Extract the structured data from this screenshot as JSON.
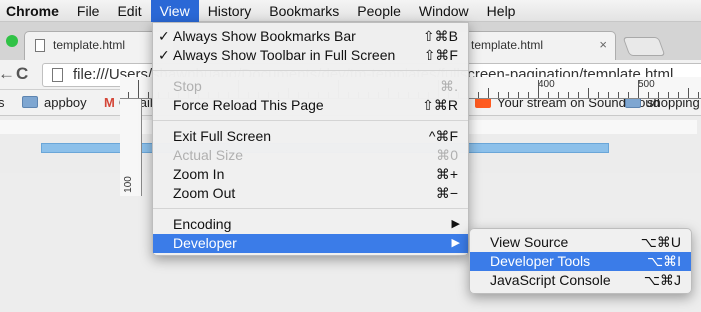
{
  "menubar": {
    "app": "Chrome",
    "items": [
      "File",
      "Edit",
      "View",
      "History",
      "Bookmarks",
      "People",
      "Window",
      "Help"
    ]
  },
  "tabs": [
    {
      "title": "template.html"
    },
    {
      "title": "template.html",
      "close": "×"
    }
  ],
  "toolbar": {
    "back": "←",
    "reload": "C",
    "url": "file:///Users/shawnhuang/Documents/dev/tm-templates/fullscreen-pagination/template.html"
  },
  "bookmarks": [
    {
      "label": "s",
      "icon": "bookmark-icon"
    },
    {
      "label": "appboy",
      "icon": "folder-icon"
    },
    {
      "label": "Gmail",
      "icon": "gmail-icon"
    },
    {
      "label": "Your stream on SoundCloud",
      "icon": "soundcloud-icon"
    },
    {
      "label": "shopping",
      "icon": "folder-icon"
    }
  ],
  "ruler": {
    "labels": [
      "400",
      "500",
      "100"
    ]
  },
  "view_menu": {
    "items": [
      {
        "check": "✓",
        "label": "Always Show Bookmarks Bar",
        "shortcut": "⇧⌘B"
      },
      {
        "check": "✓",
        "label": "Always Show Toolbar in Full Screen",
        "shortcut": "⇧⌘F"
      },
      {
        "label": "Stop",
        "shortcut": "⌘.",
        "disabled": true
      },
      {
        "label": "Force Reload This Page",
        "shortcut": "⇧⌘R"
      },
      {
        "label": "Exit Full Screen",
        "shortcut": "^⌘F"
      },
      {
        "label": "Actual Size",
        "shortcut": "⌘0",
        "disabled": true
      },
      {
        "label": "Zoom In",
        "shortcut": "⌘+"
      },
      {
        "label": "Zoom Out",
        "shortcut": "⌘−"
      },
      {
        "label": "Encoding",
        "arrow": "▶"
      },
      {
        "label": "Developer",
        "arrow": "▶",
        "highlighted": true
      }
    ]
  },
  "developer_menu": {
    "items": [
      {
        "label": "View Source",
        "shortcut": "⌥⌘U"
      },
      {
        "label": "Developer Tools",
        "shortcut": "⌥⌘I",
        "highlighted": true
      },
      {
        "label": "JavaScript Console",
        "shortcut": "⌥⌘J"
      }
    ]
  },
  "colors": {
    "menu_highlight": "#3b7ce8",
    "menubar_active": "#2a68d6"
  }
}
